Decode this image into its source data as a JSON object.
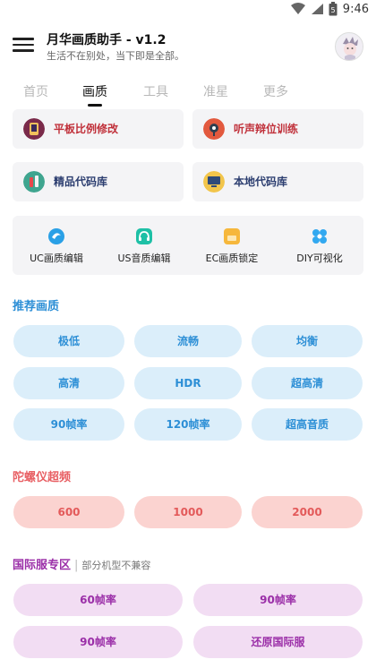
{
  "status": {
    "time": "9:46",
    "icons": [
      "wifi-icon",
      "signal-icon",
      "battery-icon"
    ]
  },
  "app": {
    "title": "月华画质助手 - v1.2",
    "subtitle": "生活不在别处，当下即是全部。"
  },
  "tabs": [
    {
      "label": "首页",
      "active": false
    },
    {
      "label": "画质",
      "active": true
    },
    {
      "label": "工具",
      "active": false
    },
    {
      "label": "准星",
      "active": false
    },
    {
      "label": "更多",
      "active": false
    }
  ],
  "cards": [
    {
      "label": "平板比例修改",
      "icon": "tablet-icon"
    },
    {
      "label": "听声辩位训练",
      "icon": "headphone-icon"
    },
    {
      "label": "精品代码库",
      "icon": "code-bottle-icon"
    },
    {
      "label": "本地代码库",
      "icon": "computer-icon"
    }
  ],
  "tools": [
    {
      "label": "UC画质编辑",
      "icon": "uc-icon"
    },
    {
      "label": "US音质编辑",
      "icon": "headset-icon"
    },
    {
      "label": "EC画质锁定",
      "icon": "lock-box-icon"
    },
    {
      "label": "DIY可视化",
      "icon": "diy-icon"
    }
  ],
  "recommended": {
    "title": "推荐画质",
    "options": [
      "极低",
      "流畅",
      "均衡",
      "高清",
      "HDR",
      "超高清",
      "90帧率",
      "120帧率",
      "超高音质"
    ]
  },
  "gyro": {
    "title": "陀螺仪超频",
    "options": [
      "600",
      "1000",
      "2000"
    ]
  },
  "intl": {
    "title": "国际服专区",
    "separator": "|",
    "note": "部分机型不兼容",
    "options": [
      "60帧率",
      "90帧率",
      "90帧率",
      "还原国际服"
    ]
  },
  "colors": {
    "blue": "#2d8fd6",
    "red": "#e35a5a",
    "purple": "#9b2fa8",
    "card_red": "#c0303a"
  }
}
